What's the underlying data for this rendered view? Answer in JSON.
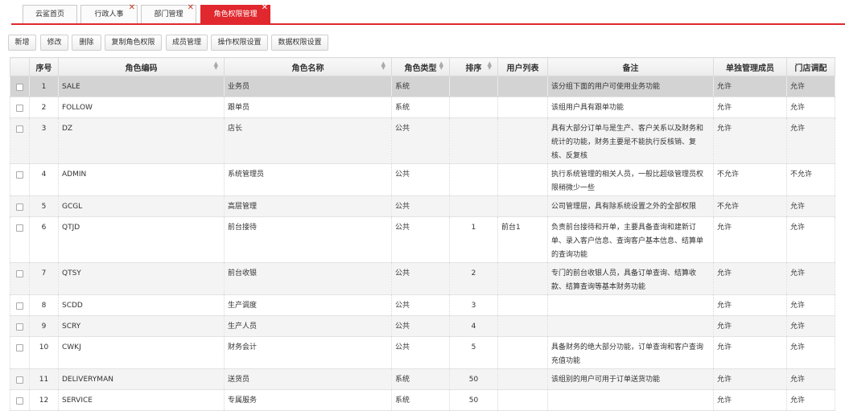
{
  "tabs": [
    {
      "label": "云鲨首页",
      "closable": false,
      "active": false
    },
    {
      "label": "行政人事",
      "closable": true,
      "active": false
    },
    {
      "label": "部门管理",
      "closable": true,
      "active": false
    },
    {
      "label": "角色权限管理",
      "closable": true,
      "active": true
    }
  ],
  "toolbar": {
    "buttons": [
      "新增",
      "修改",
      "删除",
      "复制角色权限",
      "成员管理",
      "操作权限设置",
      "数据权限设置"
    ]
  },
  "table": {
    "columns": [
      "序号",
      "角色编码",
      "角色名称",
      "角色类型",
      "排序",
      "用户列表",
      "备注",
      "单独管理成员",
      "门店调配"
    ],
    "sortable": [
      false,
      true,
      true,
      true,
      true,
      false,
      false,
      false,
      false
    ],
    "rows": [
      {
        "no": "1",
        "code": "SALE",
        "name": "业务员",
        "type": "系统",
        "sort": "",
        "users": "",
        "remark": "该分组下面的用户可使用业务功能",
        "single": "允许",
        "store": "允许",
        "selected": true
      },
      {
        "no": "2",
        "code": "FOLLOW",
        "name": "跟单员",
        "type": "系统",
        "sort": "",
        "users": "",
        "remark": "该组用户具有跟单功能",
        "single": "允许",
        "store": "允许"
      },
      {
        "no": "3",
        "code": "DZ",
        "name": "店长",
        "type": "公共",
        "sort": "",
        "users": "",
        "remark": "具有大部分订单与是生产、客户关系以及财务和统计的功能，财务主要是不能执行反核销、复核、反复核",
        "single": "允许",
        "store": "允许"
      },
      {
        "no": "4",
        "code": "ADMIN",
        "name": "系统管理员",
        "type": "公共",
        "sort": "",
        "users": "",
        "remark": "执行系统管理的相关人员，一般比超级管理员权限稍微少一些",
        "single": "不允许",
        "store": "不允许"
      },
      {
        "no": "5",
        "code": "GCGL",
        "name": "高层管理",
        "type": "公共",
        "sort": "",
        "users": "",
        "remark": "公司管理层，具有除系统设置之外的全部权限",
        "single": "不允许",
        "store": "允许"
      },
      {
        "no": "6",
        "code": "QTJD",
        "name": "前台接待",
        "type": "公共",
        "sort": "1",
        "users": "前台1",
        "remark": "负责前台接待和开单，主要具备查询和建新订单、录入客户信息、查询客户基本信息、结算单的查询功能",
        "single": "允许",
        "store": "允许"
      },
      {
        "no": "7",
        "code": "QTSY",
        "name": "前台收银",
        "type": "公共",
        "sort": "2",
        "users": "",
        "remark": "专门的前台收银人员，具备订单查询、结算收款、结算查询等基本财务功能",
        "single": "允许",
        "store": "允许"
      },
      {
        "no": "8",
        "code": "SCDD",
        "name": "生产调度",
        "type": "公共",
        "sort": "3",
        "users": "",
        "remark": "",
        "single": "允许",
        "store": "允许"
      },
      {
        "no": "9",
        "code": "SCRY",
        "name": "生产人员",
        "type": "公共",
        "sort": "4",
        "users": "",
        "remark": "",
        "single": "允许",
        "store": "允许"
      },
      {
        "no": "10",
        "code": "CWKJ",
        "name": "财务会计",
        "type": "公共",
        "sort": "5",
        "users": "",
        "remark": "具备财务的绝大部分功能，订单查询和客户查询充值功能",
        "single": "允许",
        "store": "允许"
      },
      {
        "no": "11",
        "code": "DELIVERYMAN",
        "name": "送货员",
        "type": "系统",
        "sort": "50",
        "users": "",
        "remark": "该组别的用户可用于订单送货功能",
        "single": "允许",
        "store": "允许"
      },
      {
        "no": "12",
        "code": "SERVICE",
        "name": "专属服务",
        "type": "系统",
        "sort": "50",
        "users": "",
        "remark": "",
        "single": "允许",
        "store": "允许"
      }
    ]
  },
  "colors": {
    "accent": "#e0282e",
    "selected_row": "#d3d3d3",
    "alt_row": "#f4f4f4"
  }
}
